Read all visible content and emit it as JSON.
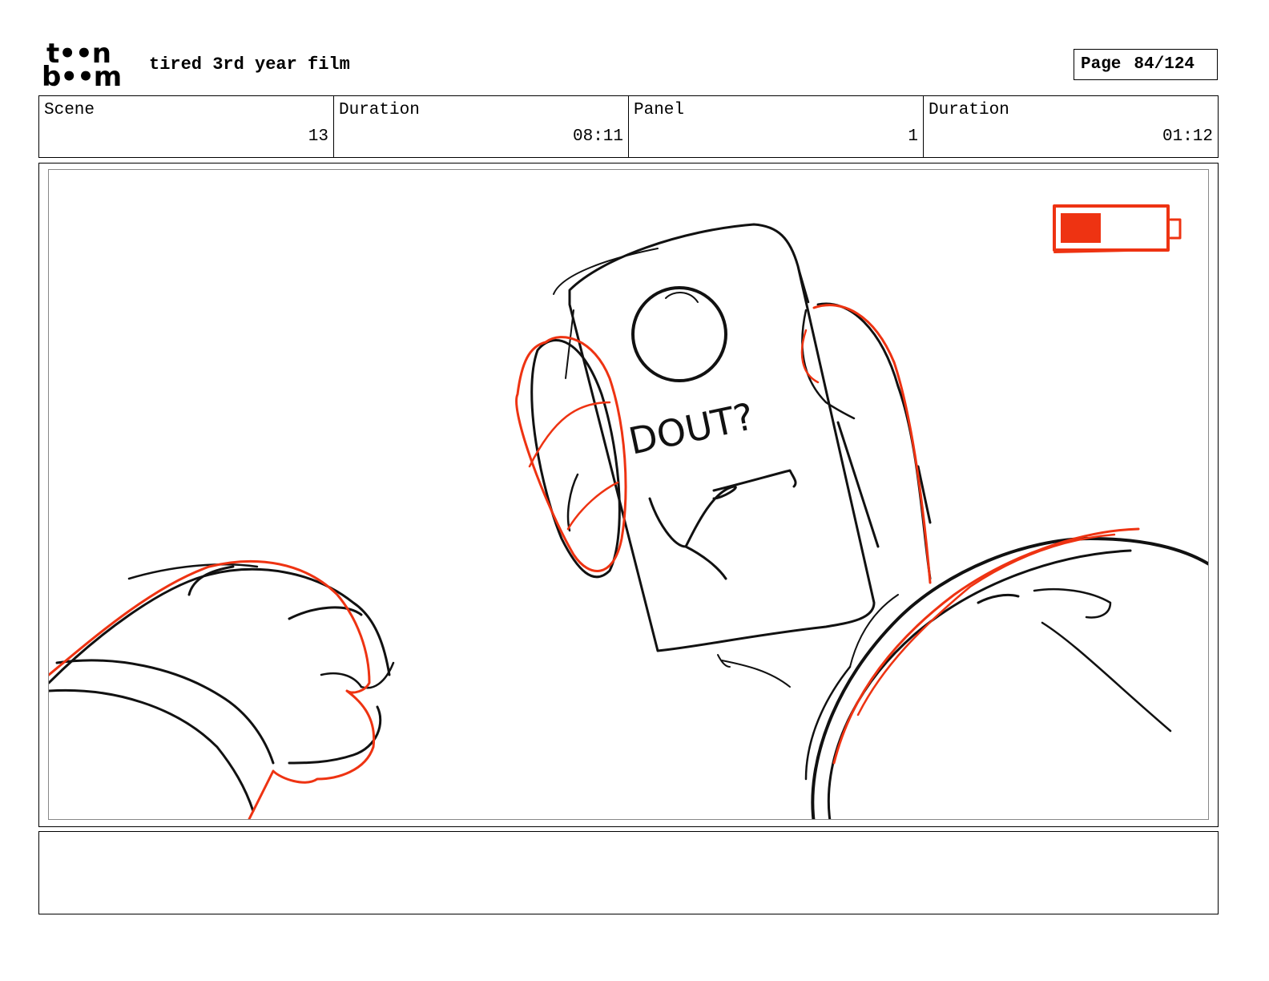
{
  "header": {
    "logo_top": "t••n",
    "logo_bottom": "b••m",
    "project_title": "tired 3rd year film",
    "page_label": "Page",
    "page_number": "84/124"
  },
  "info_bar": {
    "scene_label": "Scene",
    "scene_value": "13",
    "scene_duration_label": "Duration",
    "scene_duration_value": "08:11",
    "panel_label": "Panel",
    "panel_value": "1",
    "panel_duration_label": "Duration",
    "panel_duration_value": "01:12"
  },
  "panel": {
    "phone_screen_text": "DOUT?",
    "battery_level": 0.4
  },
  "colors": {
    "sketch_line": "#111111",
    "sketch_accent": "#ee3312",
    "battery": "#ee3312"
  },
  "notes": {
    "text": ""
  }
}
